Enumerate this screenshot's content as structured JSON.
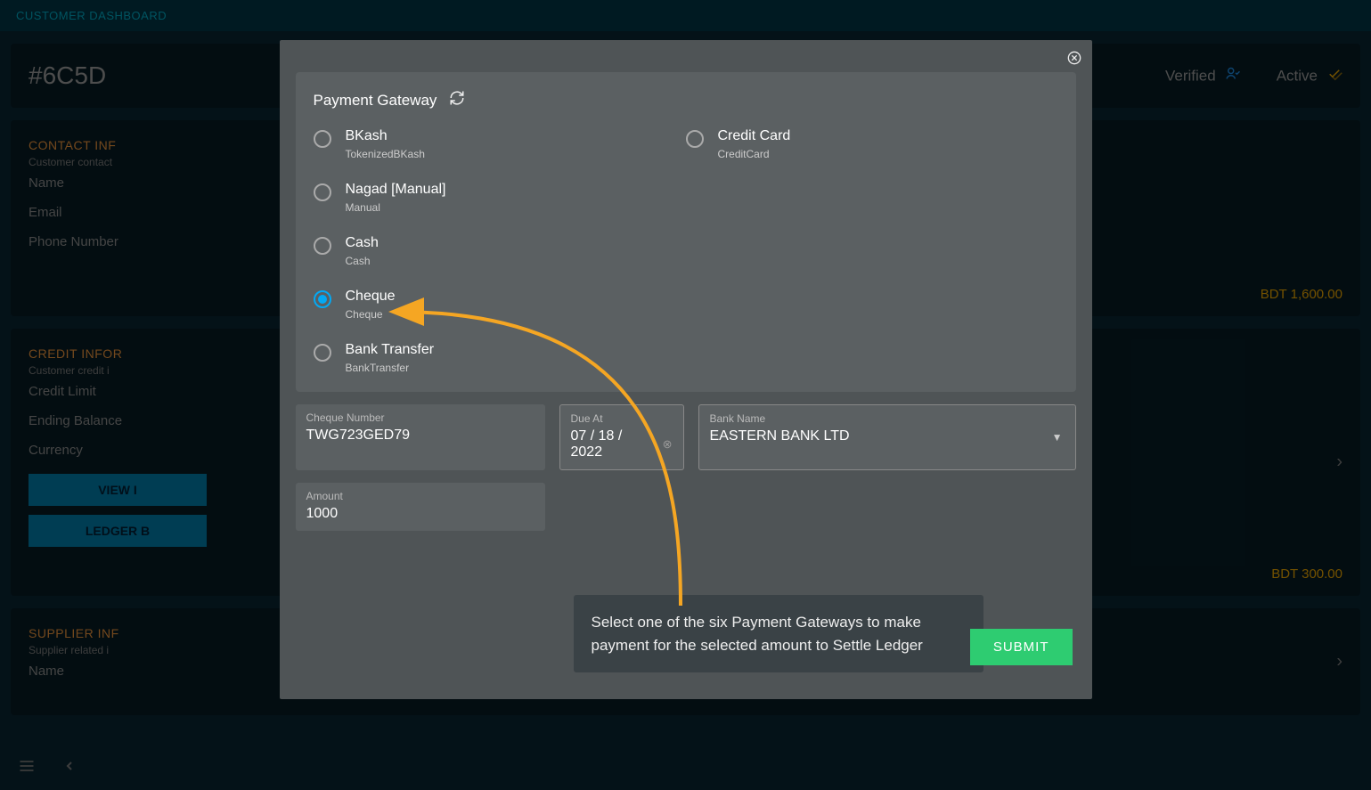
{
  "header": {
    "title": "CUSTOMER DASHBOARD"
  },
  "customer": {
    "id": "#6C5D",
    "verified": "Verified",
    "active": "Active"
  },
  "contact": {
    "title": "CONTACT INF",
    "sub": "Customer contact",
    "name": "Name",
    "email": "Email",
    "phone": "Phone Number",
    "amount": "BDT 1,600.00"
  },
  "credit": {
    "title": "CREDIT INFOR",
    "sub": "Customer credit i",
    "limit": "Credit Limit",
    "balance": "Ending Balance",
    "currency": "Currency",
    "viewbtn": "VIEW I",
    "ledgerbtn": "LEDGER B",
    "amount": "BDT 300.00"
  },
  "supplier": {
    "title": "SUPPLIER INF",
    "sub": "Supplier related i",
    "name": "Name"
  },
  "modal": {
    "title": "Payment Gateway",
    "gateways": [
      {
        "label": "BKash",
        "sub": "TokenizedBKash",
        "selected": false
      },
      {
        "label": "Nagad [Manual]",
        "sub": "Manual",
        "selected": false
      },
      {
        "label": "Cash",
        "sub": "Cash",
        "selected": false
      },
      {
        "label": "Cheque",
        "sub": "Cheque",
        "selected": true
      },
      {
        "label": "Bank Transfer",
        "sub": "BankTransfer",
        "selected": false
      }
    ],
    "gateways2": [
      {
        "label": "Credit Card",
        "sub": "CreditCard",
        "selected": false
      }
    ],
    "cheque_label": "Cheque Number",
    "cheque_value": "TWG723GED79",
    "due_label": "Due At",
    "due_value": "07 / 18 / 2022",
    "bank_label": "Bank Name",
    "bank_value": "EASTERN BANK LTD",
    "amount_label": "Amount",
    "amount_value": "1000",
    "tooltip": "Select one of the six Payment Gateways to make payment for the selected amount to Settle Ledger",
    "submit": "SUBMIT"
  }
}
